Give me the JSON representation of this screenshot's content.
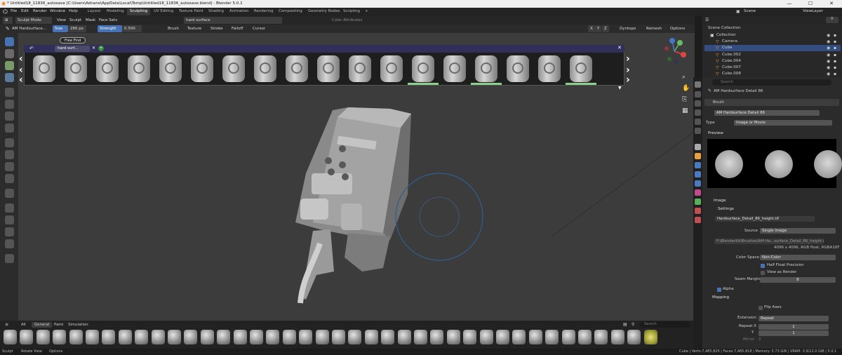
{
  "titlebar": {
    "title": "* Untitled18_11836_autosave [C:\\Users\\Adnano\\AppData\\Local\\Temp\\Untitled18_11836_autosave.blend] - Blender 5.0.1",
    "min": "—",
    "max": "☐",
    "close": "✕"
  },
  "menus": [
    "File",
    "Edit",
    "Render",
    "Window",
    "Help"
  ],
  "workspaces": [
    "Layout",
    "Modeling",
    "Sculpting",
    "UV Editing",
    "Texture Paint",
    "Shading",
    "Animation",
    "Rendering",
    "Compositing",
    "Geometry Nodes",
    "Scripting",
    "+"
  ],
  "active_workspace": "Sculpting",
  "scene": {
    "label": "Scene",
    "view_layer": "ViewLayer"
  },
  "header": {
    "mode": "Sculpt Mode",
    "view": "View",
    "sculpt": "Sculpt",
    "mask": "Mask",
    "face_sets": "Face Sets",
    "search": "hard surface",
    "color_attributes": "Color Attributes"
  },
  "toolhdr": {
    "brush": "AM Hardsurface...",
    "size_label": "Size",
    "size_value": "266 px",
    "strength_label": "Strength",
    "strength_value": "0.500",
    "brush_menu": "Brush",
    "texture": "Texture",
    "stroke": "Stroke",
    "falloff": "Falloff",
    "cursor": "Cursor",
    "axes": [
      "X",
      "Y",
      "Z"
    ],
    "dyntopo": "Dyntopo",
    "remesh": "Remesh",
    "options": "Options"
  },
  "asset_browser": {
    "search": "hard surf...",
    "filter_tag": "Free Find",
    "thumb_count": 18
  },
  "shelf": {
    "tabs": [
      "All",
      "General",
      "Paint",
      "Simulation"
    ],
    "active": "General",
    "search_placeholder": "Search"
  },
  "outliner": {
    "title": "Scene Collection",
    "items": [
      {
        "name": "Collection",
        "sel": false,
        "indent": 1
      },
      {
        "name": "Camera",
        "sel": false,
        "indent": 2
      },
      {
        "name": "Cube",
        "sel": true,
        "indent": 2
      },
      {
        "name": "Cube.002",
        "sel": false,
        "indent": 2
      },
      {
        "name": "Cube.004",
        "sel": false,
        "indent": 2
      },
      {
        "name": "Cube.007",
        "sel": false,
        "indent": 2
      },
      {
        "name": "Cube.008",
        "sel": false,
        "indent": 2
      }
    ]
  },
  "properties": {
    "search_placeholder": "Search",
    "brush_name": "AM Hardsurface Detail 86",
    "brush_label": "Brush",
    "brush_field": "AM Hardsurface Detail 86",
    "type_label": "Type",
    "type_value": "Image or Movie",
    "preview_label": "Preview",
    "image_label": "Image",
    "settings_label": "Settings",
    "image_file": "Hardsurface_Detail_86_height.tif",
    "source_label": "Source",
    "source_value": "Single Image",
    "path": "F:\\BlenderKit\\Brushes\\AM Ha...surface_Detail_86_height.tif",
    "info": "4096 x 4096,  RGB float, RGBA16F",
    "color_space_label": "Color Space",
    "color_space_value": "Non-Color",
    "half_float": "Half Float Precision",
    "view_as_render": "View as Render",
    "seam_margin_label": "Seam Margin",
    "seam_margin_value": "8",
    "alpha": "Alpha",
    "mapping": "Mapping",
    "flip_axes": "Flip Axes",
    "extension_label": "Extension",
    "extension_value": "Repeat",
    "repeat_x_label": "Repeat X",
    "repeat_x": "1",
    "repeat_y_label": "Y",
    "repeat_y": "1",
    "mirror_label": "Mirror",
    "mirror_x": "X"
  },
  "status": {
    "left1": "Sculpt",
    "left2": "Rotate View",
    "left3": "Options",
    "right": "Cube | Verts:7,485,820 | Faces:7,485,818 | Memory: 5.73 GiB | VRAM: 3.9/12.0 GiB | 5.0.1"
  }
}
